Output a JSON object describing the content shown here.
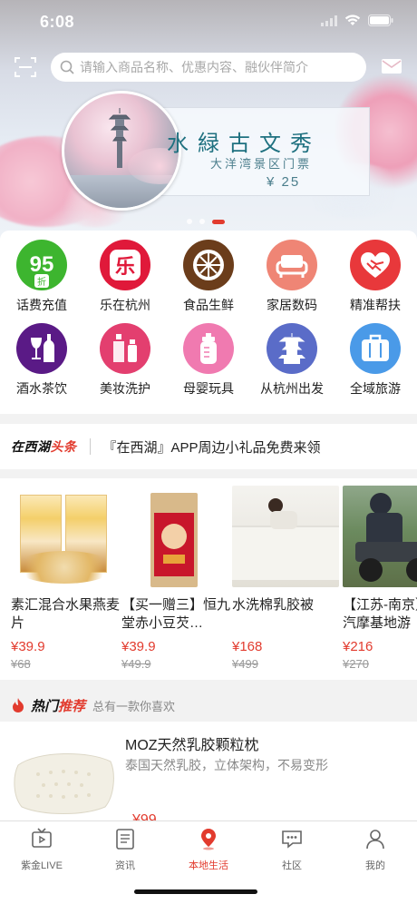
{
  "status": {
    "time": "6:08"
  },
  "search": {
    "placeholder": "请输入商品名称、优惠内容、融伙伴简介"
  },
  "banner": {
    "title": "水緑古文秀",
    "subtitle": "大洋湾景区门票",
    "price": "¥ 25",
    "slide_count": 3,
    "active_slide": 3
  },
  "categories": [
    {
      "label": "话费充值",
      "icon": "discount-95-icon",
      "color": "#3db52f",
      "badge": "95",
      "badge_sub": "折"
    },
    {
      "label": "乐在杭州",
      "icon": "le-icon",
      "color": "#e0193a",
      "badge": "乐"
    },
    {
      "label": "食品生鲜",
      "icon": "orange-slice-icon",
      "color": "#6b3d1b"
    },
    {
      "label": "家居数码",
      "icon": "sofa-icon",
      "color": "#ef8575"
    },
    {
      "label": "精准帮扶",
      "icon": "handshake-icon",
      "color": "#e8383b"
    },
    {
      "label": "酒水茶饮",
      "icon": "wine-icon",
      "color": "#5a1a86"
    },
    {
      "label": "美妆洗护",
      "icon": "cosmetics-icon",
      "color": "#e33f6f"
    },
    {
      "label": "母婴玩具",
      "icon": "baby-bottle-icon",
      "color": "#f07ab0"
    },
    {
      "label": "从杭州出发",
      "icon": "pagoda-icon",
      "color": "#5a6cc8"
    },
    {
      "label": "全域旅游",
      "icon": "suitcase-icon",
      "color": "#4a9ae8"
    }
  ],
  "news": {
    "logo_black": "在西湖",
    "logo_red": "头条",
    "text": "『在西湖』APP周边小礼品免费来领"
  },
  "products": [
    {
      "name": "素汇混合水果燕麦片",
      "price": "¥39.9",
      "original": "¥68"
    },
    {
      "name": "【买一赠三】恒九堂赤小豆芡…",
      "price": "¥39.9",
      "original": "¥49.9"
    },
    {
      "name": "水洗棉乳胶被",
      "price": "¥168",
      "original": "¥499"
    },
    {
      "name": "【江苏-南京】山汽摩基地游",
      "price": "¥216",
      "original": "¥270"
    }
  ],
  "hot": {
    "title_black": "热门",
    "title_red": "推荐",
    "subtitle": "总有一款你喜欢",
    "item": {
      "title": "MOZ天然乳胶颗粒枕",
      "desc": "泰国天然乳胶，立体架构，不易变形",
      "price": "¥99"
    }
  },
  "tabs": [
    {
      "label": "紫金LIVE",
      "icon": "tv-icon",
      "active": false
    },
    {
      "label": "资讯",
      "icon": "news-list-icon",
      "active": false
    },
    {
      "label": "本地生活",
      "icon": "location-pin-icon",
      "active": true
    },
    {
      "label": "社区",
      "icon": "chat-bubble-icon",
      "active": false
    },
    {
      "label": "我的",
      "icon": "person-icon",
      "active": false
    }
  ],
  "colors": {
    "accent": "#e23b2e",
    "search_placeholder": "#a8a8a8"
  }
}
